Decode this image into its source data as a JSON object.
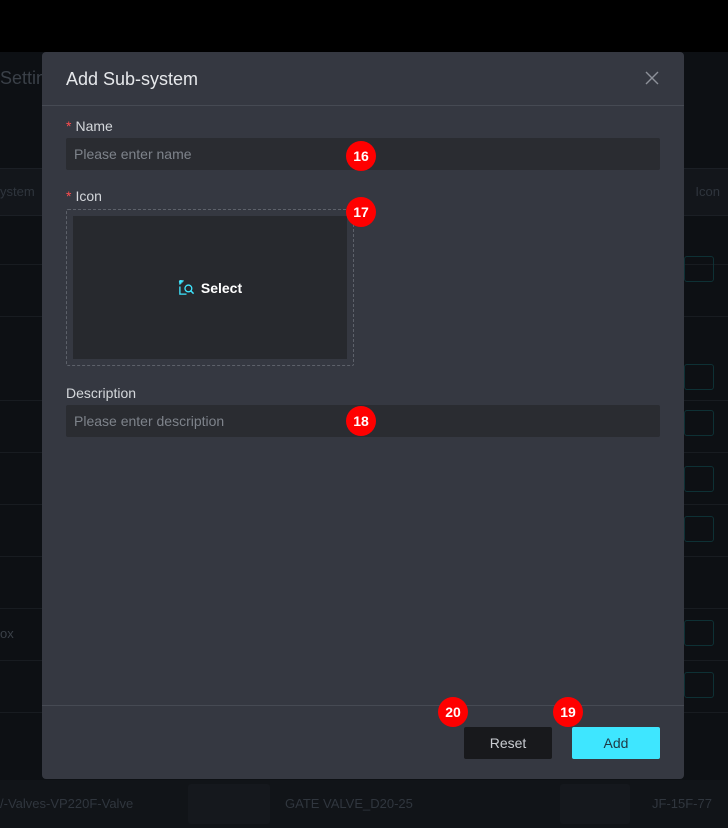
{
  "background": {
    "title": "Settin",
    "column_left": "ystem",
    "column_right": "Icon",
    "left_row_text": "ox",
    "footer_items": [
      "/-Valves-VP220F-Valve",
      "GATE VALVE_D20-25",
      "JF-15F-77"
    ]
  },
  "modal": {
    "title": "Add Sub-system",
    "close_icon": "close-icon",
    "name": {
      "required_mark": "*",
      "label": "Name",
      "placeholder": "Please enter name",
      "value": ""
    },
    "icon": {
      "required_mark": "*",
      "label": "Icon",
      "select_label": "Select",
      "select_icon": "image-search-icon"
    },
    "description": {
      "label": "Description",
      "placeholder": "Please enter description",
      "value": ""
    },
    "buttons": {
      "reset_label": "Reset",
      "add_label": "Add"
    }
  },
  "badges": {
    "name": "16",
    "icon": "17",
    "description": "18",
    "add": "19",
    "reset": "20"
  },
  "colors": {
    "accent": "#3ee6ff",
    "required": "#ff4d4f",
    "badge": "#ff0000"
  }
}
